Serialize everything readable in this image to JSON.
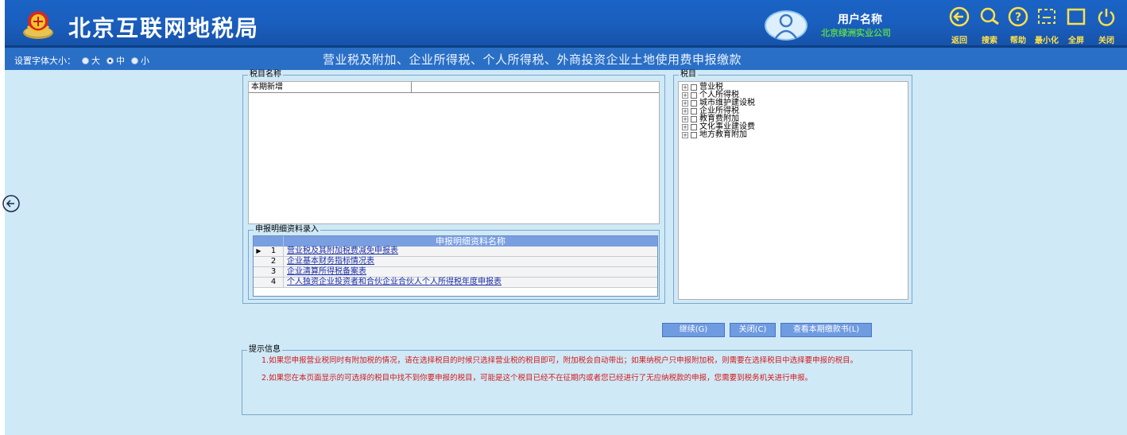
{
  "header": {
    "site_title": "北京互联网地税局",
    "user_label": "用户名称",
    "company": "北京绿洲实业公司",
    "toolbar": [
      {
        "label": "返回",
        "icon": "back-arrow-icon"
      },
      {
        "label": "搜索",
        "icon": "search-icon"
      },
      {
        "label": "帮助",
        "icon": "help-icon"
      },
      {
        "label": "最小化",
        "icon": "minimize-icon"
      },
      {
        "label": "全屏",
        "icon": "fullscreen-icon"
      },
      {
        "label": "关闭",
        "icon": "power-icon"
      }
    ],
    "colors": {
      "bar": "#1a5fbf",
      "toolbar_icon": "#ffe14a",
      "company": "#58d24f"
    }
  },
  "titlebar": {
    "font_size_label": "设置字体大小：",
    "font_options": [
      {
        "label": "大",
        "selected": false
      },
      {
        "label": "中",
        "selected": true
      },
      {
        "label": "小",
        "selected": false
      }
    ],
    "page_title": "营业税及附加、企业所得税、个人所得税、外商投资企业土地使用费申报缴款"
  },
  "tax_name": {
    "legend": "税目名称",
    "column_header": "本期新增"
  },
  "detail": {
    "legend": "申报明细资料录入",
    "column_header": "申报明细资料名称",
    "rows": [
      {
        "num": "1",
        "name": "营业税及其附加税费减免申报表",
        "current": true
      },
      {
        "num": "2",
        "name": "企业基本财务指标情况表",
        "current": false
      },
      {
        "num": "3",
        "name": "企业清算所得税备案表",
        "current": false
      },
      {
        "num": "4",
        "name": "个人独资企业投资者和合伙企业合伙人个人所得税年度申报表",
        "current": false
      }
    ]
  },
  "tax_items": {
    "legend": "税目",
    "items": [
      "营业税",
      "个人所得税",
      "城市维护建设税",
      "企业所得税",
      "教育费附加",
      "文化事业建设费",
      "地方教育附加"
    ]
  },
  "buttons": {
    "continue": "继续(G)",
    "close": "关闭(C)",
    "view": "查看本期缴款书(L)"
  },
  "hint": {
    "legend": "提示信息",
    "p1": "1.如果您申报营业税同时有附加税的情况，请在选择税目的时候只选择营业税的税目即可，附加税会自动带出；如果纳税户只申报附加税，则需要在选择税目中选择要申报的税目。",
    "p2": "2.如果您在本页面显示的可选择的税目中找不到你要申报的税目，可能是这个税目已经不在征期内或者您已经进行了无应纳税款的申报，您需要到税务机关进行申报。",
    "color": "#d21a1a"
  }
}
